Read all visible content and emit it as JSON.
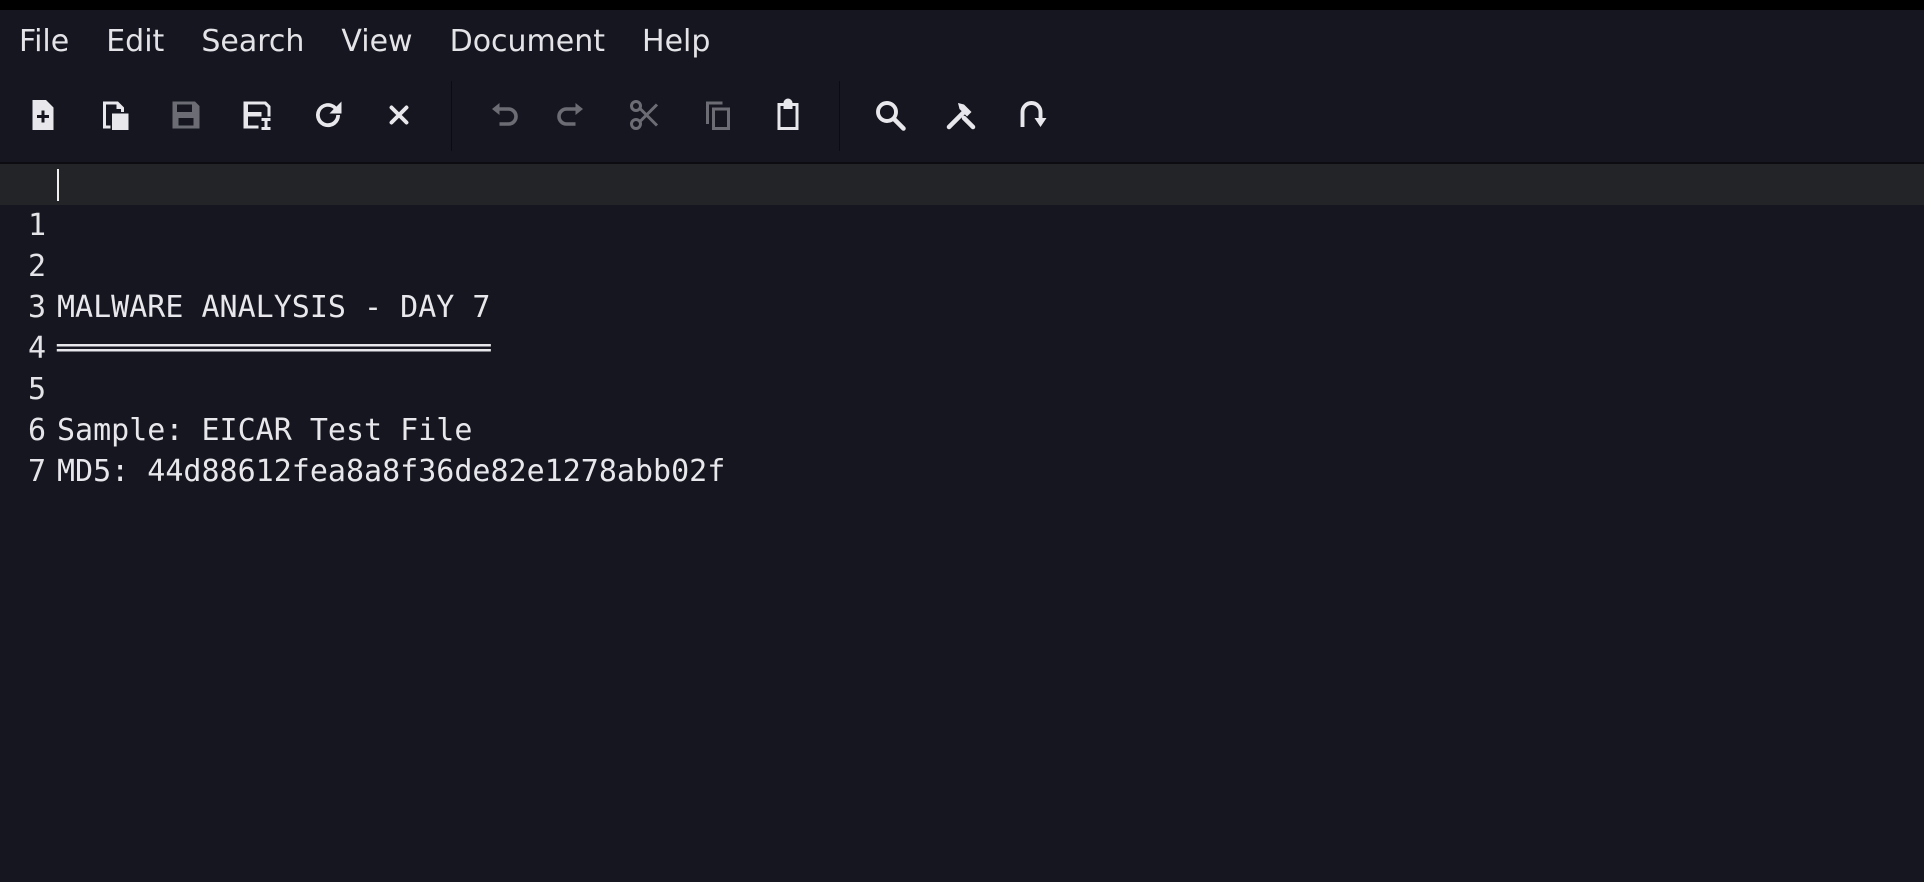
{
  "menu": {
    "items": [
      "File",
      "Edit",
      "Search",
      "View",
      "Document",
      "Help"
    ]
  },
  "toolbar": {
    "buttons": [
      {
        "icon": "new-document-icon",
        "enabled": true
      },
      {
        "icon": "open-document-icon",
        "enabled": true
      },
      {
        "icon": "save-icon",
        "enabled": false
      },
      {
        "icon": "save-as-icon",
        "enabled": true
      },
      {
        "icon": "reload-icon",
        "enabled": true
      },
      {
        "icon": "close-icon",
        "enabled": true
      },
      {
        "icon": "undo-icon",
        "enabled": false
      },
      {
        "icon": "redo-icon",
        "enabled": false
      },
      {
        "icon": "cut-icon",
        "enabled": false
      },
      {
        "icon": "copy-icon",
        "enabled": false
      },
      {
        "icon": "paste-icon",
        "enabled": true
      },
      {
        "icon": "find-icon",
        "enabled": true
      },
      {
        "icon": "find-replace-icon",
        "enabled": true
      },
      {
        "icon": "goto-line-icon",
        "enabled": true
      }
    ],
    "colors": {
      "enabled": "#e8e8ec",
      "disabled": "#6c6d74"
    }
  },
  "editor": {
    "current_line": 1,
    "lines": [
      {
        "num": "1",
        "text": ""
      },
      {
        "num": "2",
        "text": "MALWARE ANALYSIS - DAY 7"
      },
      {
        "num": "3",
        "text": "════════════════════════"
      },
      {
        "num": "4",
        "text": ""
      },
      {
        "num": "5",
        "text": "Sample: EICAR Test File"
      },
      {
        "num": "6",
        "text": "MD5: 44d88612fea8a8f36de82e1278abb02f"
      },
      {
        "num": "7",
        "text": ""
      }
    ]
  },
  "colors": {
    "background": "#15161f",
    "current_line": "#232428",
    "text": "#e8e8ec"
  }
}
